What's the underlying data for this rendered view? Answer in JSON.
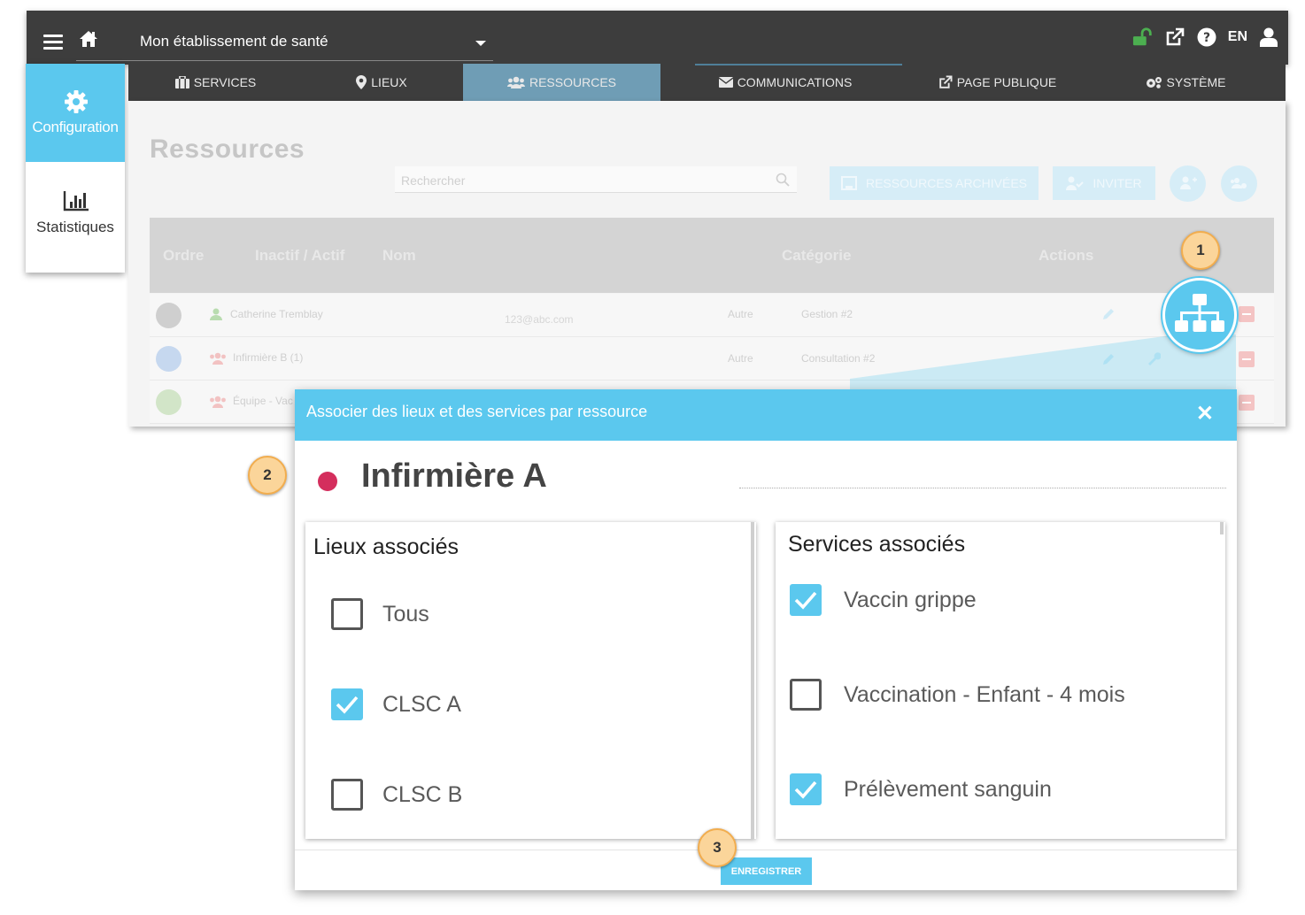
{
  "topbar": {
    "establishment": "Mon établissement de santé",
    "language": "EN"
  },
  "sidebar": {
    "items": [
      {
        "label": "Configuration",
        "icon": "gear-icon",
        "active": true
      },
      {
        "label": "Statistiques",
        "icon": "bar-chart-icon",
        "active": false
      }
    ]
  },
  "tabs": [
    {
      "label": "SERVICES",
      "icon": "briefcase-icon"
    },
    {
      "label": "LIEUX",
      "icon": "map-marker-icon"
    },
    {
      "label": "RESSOURCES",
      "icon": "users-icon",
      "active": true
    },
    {
      "label": "COMMUNICATIONS",
      "icon": "envelope-icon"
    },
    {
      "label": "PAGE PUBLIQUE",
      "icon": "external-link-icon"
    },
    {
      "label": "SYSTÈME",
      "icon": "gears-icon"
    }
  ],
  "page": {
    "title": "Ressources",
    "search_placeholder": "Rechercher",
    "archived_button": "RESSOURCES ARCHIVÉES",
    "invite_button": "INVITER",
    "table": {
      "headers": [
        "Ordre",
        "Inactif / Actif",
        "Nom",
        "Catégorie",
        "Actions"
      ],
      "rows": [
        {
          "name": "Catherine Tremblay",
          "email": "123@abc.com",
          "type": "Autre",
          "category": "Gestion #2",
          "color": "#cfcfcf"
        },
        {
          "name": "Infirmière B (1)",
          "email": "",
          "type": "Autre",
          "category": "Consultation #2",
          "color": "#c6d8ef"
        },
        {
          "name": "Équipe - Vac",
          "email": "",
          "type": "",
          "category": "",
          "color": "#d2e5c8"
        }
      ]
    }
  },
  "modal": {
    "title": "Associer des lieux et des services par ressource",
    "resource_name": "Infirmière A",
    "resource_color": "#d42e5d",
    "locations": {
      "title": "Lieux associés",
      "items": [
        {
          "label": "Tous",
          "checked": false
        },
        {
          "label": "CLSC A",
          "checked": true
        },
        {
          "label": "CLSC B",
          "checked": false
        }
      ]
    },
    "services": {
      "title": "Services associés",
      "items": [
        {
          "label": "Vaccin grippe",
          "checked": true
        },
        {
          "label": "Vaccination - Enfant - 4 mois",
          "checked": false
        },
        {
          "label": "Prélèvement sanguin",
          "checked": true
        }
      ]
    },
    "save_label": "ENREGISTRER"
  },
  "steps": [
    "1",
    "2",
    "3"
  ],
  "colors": {
    "accent": "#5bc8ee",
    "dark_bar": "#3d3d3d",
    "active_tab": "#6f9db5",
    "badge": "#fbd59a",
    "lock_green": "#4caf50"
  }
}
